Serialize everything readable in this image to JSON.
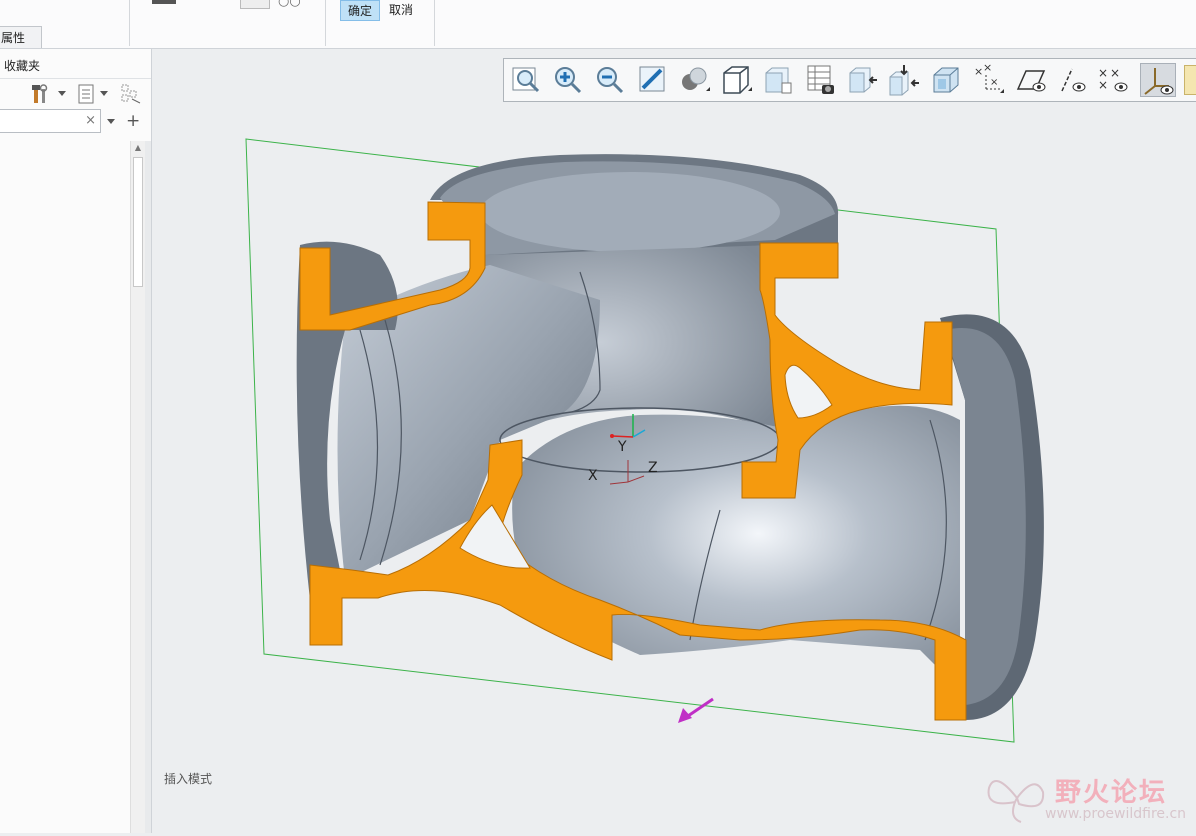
{
  "ribbon": {
    "properties_tab": "属性",
    "ok_label": "确定",
    "cancel_label": "取消"
  },
  "left_panel": {
    "favorites_label": "收藏夹",
    "search_placeholder": ""
  },
  "toolbar": {
    "buttons": [
      "zoom-to-fit-icon",
      "zoom-in-icon",
      "zoom-out-icon",
      "repaint-icon",
      "display-style-icon",
      "saved-orientations-icon",
      "view-manager-icon",
      "appearance-gallery-icon",
      "spin-center-icon",
      "annotation-display-icon",
      "datum-display-icon",
      "csys-display-icon",
      "perspective-view-icon",
      "datum-axes-icon",
      "datum-planes-icon",
      "point-display-icon",
      "csys-display-toggle-icon"
    ]
  },
  "viewport": {
    "csys_labels": {
      "x": "X",
      "y": "Y",
      "z": "Z"
    },
    "mode_text": "插入模式",
    "colors": {
      "section": "#f59a0e",
      "body": "#9aa4b0",
      "plane": "#3cb34a",
      "arrow": "#c02fc6"
    }
  },
  "watermark": {
    "title": "野火论坛",
    "url": "www.proewildfire.cn"
  }
}
